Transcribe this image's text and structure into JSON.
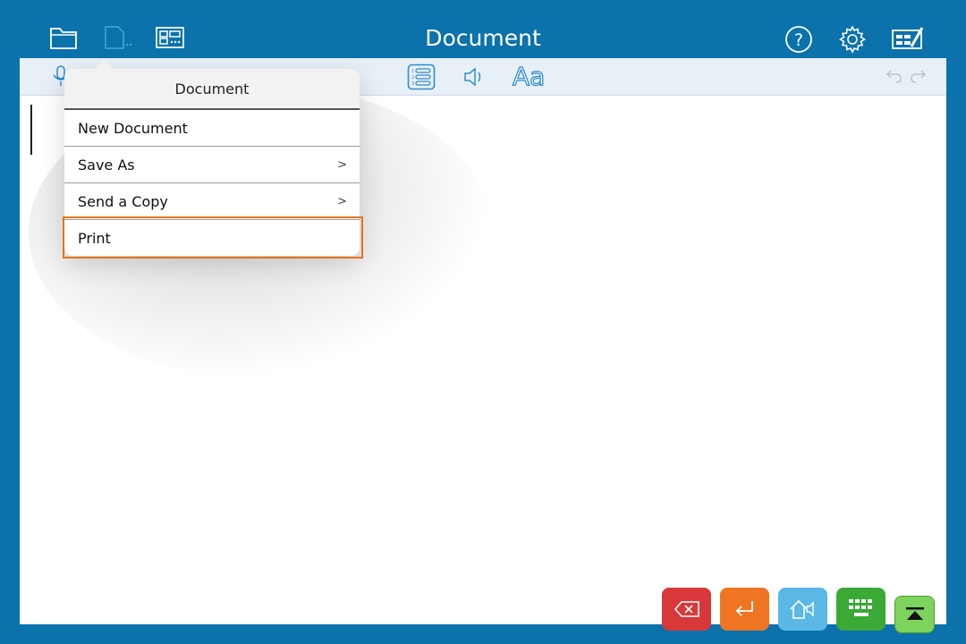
{
  "header": {
    "title": "Document",
    "icons": [
      "folder-icon",
      "document-icon",
      "layout-icon",
      "help-icon",
      "settings-icon",
      "edit-icon"
    ]
  },
  "toolbar": {
    "icons": [
      "microphone-icon",
      "numbered-list-icon",
      "speaker-icon",
      "font-icon",
      "undo-icon",
      "redo-icon"
    ],
    "font_label": "Aa"
  },
  "popover": {
    "title": "Document",
    "items": [
      {
        "label": "New Document",
        "chevron": ""
      },
      {
        "label": "Save As",
        "chevron": ">"
      },
      {
        "label": "Send a Copy",
        "chevron": ">"
      },
      {
        "label": "Print",
        "chevron": ""
      }
    ]
  },
  "keyboard_buttons": [
    {
      "name": "backspace-icon",
      "color": "#d9383a"
    },
    {
      "name": "return-icon",
      "color": "#ef7523"
    },
    {
      "name": "speak-home-icon",
      "color": "#5bb7e6"
    },
    {
      "name": "keyboard-icon",
      "color": "#3aa935"
    },
    {
      "name": "hide-keyboard-icon",
      "color": "#7dd35c"
    }
  ],
  "colors": {
    "frame": "#0b72ab",
    "highlight": "#e5731a",
    "toolbar_icon": "#2f8ccf"
  }
}
